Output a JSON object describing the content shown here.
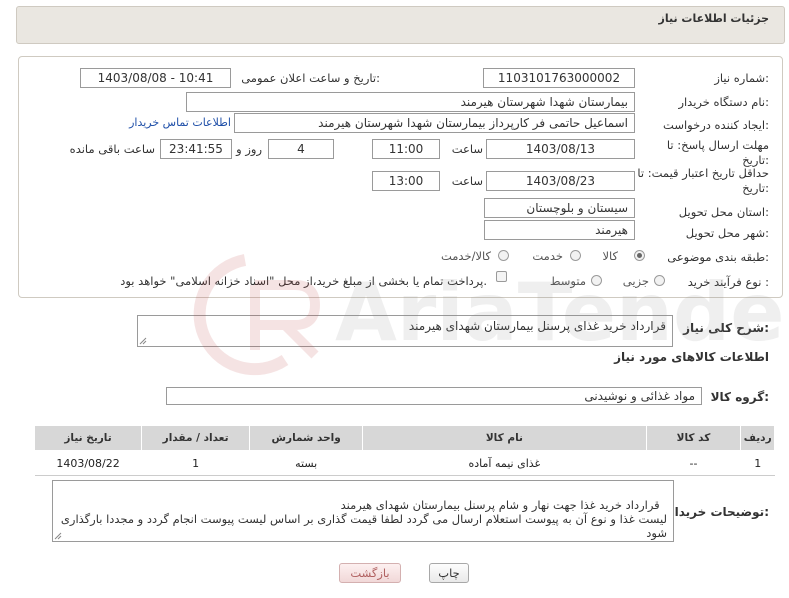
{
  "header": {
    "title": "جزئیات اطلاعات نیاز"
  },
  "fields": {
    "need_number_label": "شماره نیاز:",
    "need_number": "1103101763000002",
    "announce_label": "تاریخ و ساعت اعلان عمومی:",
    "announce_value": "1403/08/08 - 10:41",
    "buyer_label": "نام دستگاه خریدار:",
    "buyer_value": "بیمارستان شهدا شهرستان هیرمند",
    "creator_label": "ایجاد کننده درخواست:",
    "creator_value": "اسماعیل حاتمی فر کارپرداز بیمارستان شهدا شهرستان هیرمند",
    "contact_link": "اطلاعات تماس خریدار",
    "deadline_label": "مهلت ارسال پاسخ: تا تاریخ:",
    "deadline_date": "1403/08/13",
    "hour_label": "ساعت",
    "deadline_time": "11:00",
    "days_value": "4",
    "days_label": "روز و",
    "remaining_time": "23:41:55",
    "remaining_label": "ساعت باقی مانده",
    "validity_label": "حداقل تاریخ اعتبار قیمت: تا تاریخ:",
    "validity_date": "1403/08/23",
    "validity_hour_label": "ساعت",
    "validity_time": "13:00",
    "province_label": "استان محل تحویل:",
    "province_value": "سیستان و بلوچستان",
    "city_label": "شهر محل تحویل:",
    "city_value": "هیرمند",
    "category_label": "طبقه بندی موضوعی:",
    "category_options": [
      "کالا",
      "خدمت",
      "کالا/خدمت"
    ],
    "category_selected": "کالا",
    "process_label": "نوع فرآیند خرید :",
    "process_options": [
      "جزیی",
      "متوسط"
    ],
    "payment_note": "پرداخت تمام یا بخشی از مبلغ خرید،از محل \"اسناد خزانه اسلامی\" خواهد بود."
  },
  "summary": {
    "label": "شرح کلی نیاز:",
    "value": "قرارداد خرید غذای پرسنل بیمارستان شهدای هیرمند"
  },
  "goods": {
    "section_title": "اطلاعات کالاهای مورد نیاز",
    "group_label": "گروه کالا:",
    "group_value": "مواد غذائی و نوشیدنی",
    "columns": [
      "ردیف",
      "کد کالا",
      "نام کالا",
      "واحد شمارش",
      "تعداد / مقدار",
      "تاریخ نیاز"
    ],
    "rows": [
      {
        "row": "1",
        "code": "--",
        "name": "غذای نیمه آماده",
        "unit": "بسته",
        "qty": "1",
        "date": "1403/08/22"
      }
    ]
  },
  "buyer_notes": {
    "label": "توضیحات خریدار:",
    "text": "قرارداد خرید غذا جهت نهار و شام پرسنل بیمارستان شهدای هیرمند\nلیست غذا و نوع آن به پیوست استعلام ارسال می گردد لطفا قیمت گذاری بر اساس لیست پیوست انجام گردد و مجددا بارگذاری شود"
  },
  "buttons": {
    "print": "چاپ",
    "back": "بازگشت"
  },
  "watermark": {
    "text": "AriaTender.neT"
  },
  "colors": {
    "header_bg": "#eae7e1",
    "table_header_bg": "#d7d7d7",
    "link": "#1f4fa8"
  }
}
